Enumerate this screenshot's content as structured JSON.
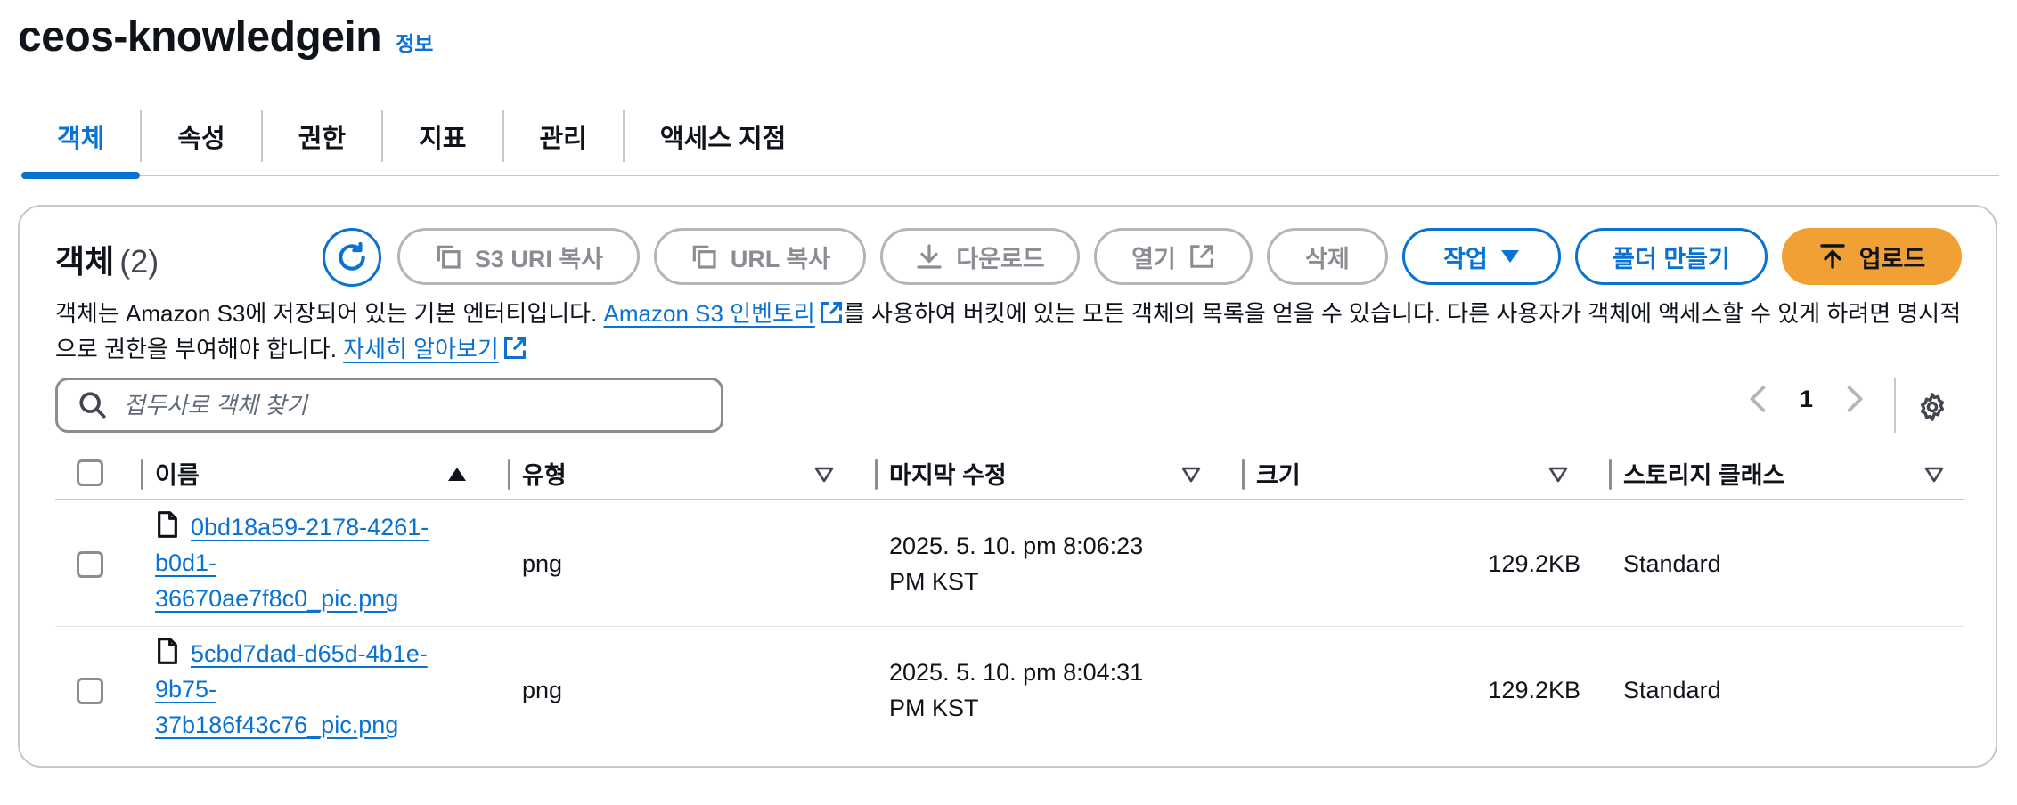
{
  "page": {
    "title": "ceos-knowledgein",
    "info_label": "정보"
  },
  "tabs": [
    {
      "label": "객체",
      "active": true
    },
    {
      "label": "속성",
      "active": false
    },
    {
      "label": "권한",
      "active": false
    },
    {
      "label": "지표",
      "active": false
    },
    {
      "label": "관리",
      "active": false
    },
    {
      "label": "액세스 지점",
      "active": false
    }
  ],
  "objects": {
    "title": "객체",
    "count": "(2)",
    "buttons": {
      "copy_s3_uri": "S3 URI 복사",
      "copy_url": "URL 복사",
      "download": "다운로드",
      "open": "열기",
      "delete": "삭제",
      "actions": "작업",
      "create_folder": "폴더 만들기",
      "upload": "업로드"
    },
    "description": {
      "text1": "객체는 Amazon S3에 저장되어 있는 기본 엔터티입니다. ",
      "link1": "Amazon S3 인벤토리",
      "text2": "를 사용하여 버킷에 있는 모든 객체의 목록을 얻을 수 있습니다. 다른 사용자가 객체에 액세스할 수 있게 하려면 명시적으로 권한을 부여해야 합니다. ",
      "link2": "자세히 알아보기"
    },
    "search_placeholder": "접두사로 객체 찾기",
    "page_number": "1",
    "columns": {
      "name": "이름",
      "type": "유형",
      "last_modified": "마지막 수정",
      "size": "크기",
      "storage_class": "스토리지 클래스"
    },
    "rows": [
      {
        "name": "0bd18a59-2178-4261-b0d1-36670ae7f8c0_pic.png",
        "name_lines": [
          "0bd18a59-2178-4261-",
          "b0d1-",
          "36670ae7f8c0_pic.png"
        ],
        "type": "png",
        "last_modified_line1": "2025. 5. 10. pm 8:06:23",
        "last_modified_line2": "PM KST",
        "size": "129.2KB",
        "storage_class": "Standard"
      },
      {
        "name": "5cbd7dad-d65d-4b1e-9b75-37b186f43c76_pic.png",
        "name_lines": [
          "5cbd7dad-d65d-4b1e-",
          "9b75-",
          "37b186f43c76_pic.png"
        ],
        "type": "png",
        "last_modified_line1": "2025. 5. 10. pm 8:04:31",
        "last_modified_line2": "PM KST",
        "size": "129.2KB",
        "storage_class": "Standard"
      }
    ]
  },
  "colors": {
    "accent": "#0972d3",
    "upload": "#f0a035",
    "disabled": "#8c8c94"
  },
  "icons": [
    "refresh-icon",
    "copy-icon",
    "download-icon",
    "external-link-icon",
    "caret-down-icon",
    "upload-icon",
    "search-icon",
    "chevron-left-icon",
    "chevron-right-icon",
    "settings-icon",
    "file-icon",
    "sort-ascending-icon",
    "sort-descending-icon"
  ]
}
